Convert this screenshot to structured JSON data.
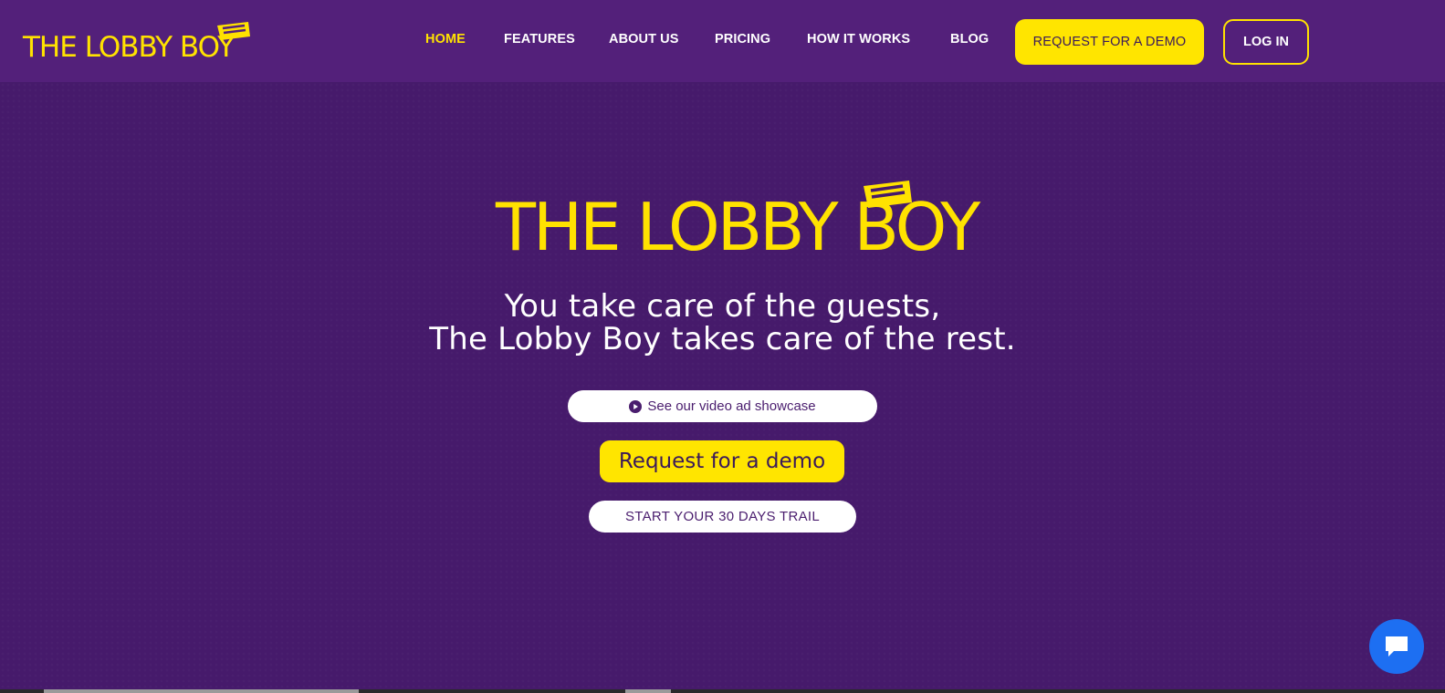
{
  "brand": {
    "name": "THE LOBBY BOY",
    "accent_color": "#ffe200",
    "background_color": "#461a6b",
    "navbar_color": "#53207a"
  },
  "nav": {
    "links": [
      {
        "label": "HOME",
        "active": true
      },
      {
        "label": "FEATURES",
        "active": false
      },
      {
        "label": "ABOUT US",
        "active": false
      },
      {
        "label": "PRICING",
        "active": false
      },
      {
        "label": "HOW IT WORKS",
        "active": false
      },
      {
        "label": "BLOG",
        "active": false
      }
    ],
    "demo_button": "REQUEST FOR A DEMO",
    "login_button": "LOG IN"
  },
  "hero": {
    "logo_text": "THE LOBBY BOY",
    "tagline_line1": "You take care of the guests,",
    "tagline_line2": "The Lobby Boy takes care of the rest.",
    "video_button": "See our video ad showcase",
    "video_icon": "play-circle-icon",
    "demo_button": "Request for a demo",
    "trial_button": "START YOUR 30 DAYS TRAIL"
  },
  "chat": {
    "icon": "chat-bubble-icon",
    "color": "#1d6ff2"
  }
}
